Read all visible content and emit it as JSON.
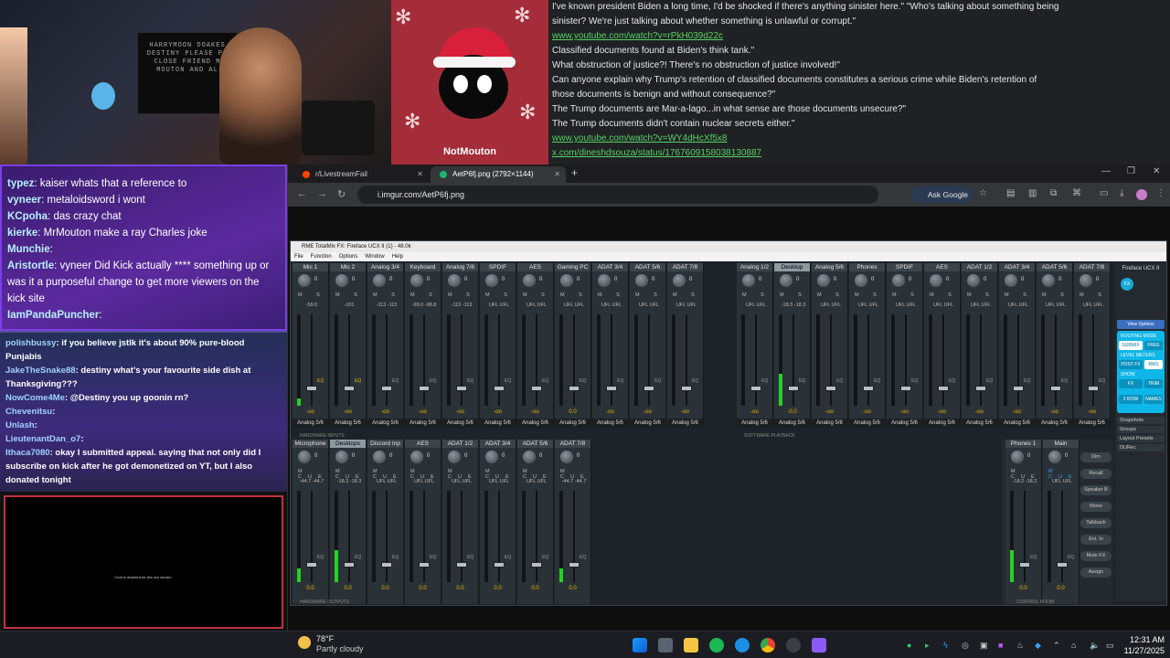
{
  "stream": {
    "webcam_shelf_text": "HARRYMOON DOAKES\nDESTINY PLEASE PL\nCLOSE FRIEND M\nMOUTON AND AL",
    "avatar_name": "NotMouton"
  },
  "article": {
    "lines": [
      {
        "text": "I've known president Biden a long time, I'd be shocked if there's anything sinister here.\" \"Who's talking about something being",
        "link": false
      },
      {
        "text": "sinister? We're just talking about whether something is unlawful or corrupt.\"",
        "link": false
      },
      {
        "text": "www.youtube.com/watch?v=rPkH039d22c",
        "link": true
      },
      {
        "text": "Classified documents found at Biden's think tank.\"",
        "link": false
      },
      {
        "text": "What obstruction of justice?! There's no obstruction of justice involved!\"",
        "link": false
      },
      {
        "text": "Can anyone explain why Trump's retention of classified documents constitutes a serious crime while Biden's retention of",
        "link": false
      },
      {
        "text": "those documents is benign and without consequence?\"",
        "link": false
      },
      {
        "text": "The Trump documents are Mar-a-lago...in what sense are those documents unsecure?\"",
        "link": false
      },
      {
        "text": "The Trump documents didn't contain nuclear secrets either.\"",
        "link": false
      },
      {
        "text": "www.youtube.com/watch?v=WY4dHcXf5x8",
        "link": true
      },
      {
        "text": "x.com/dineshdsouza/status/1767609158038130887",
        "link": true
      }
    ]
  },
  "chat_primary": [
    {
      "user": "typez",
      "text": "kaiser whats that a reference to"
    },
    {
      "user": "vyneer",
      "text": "metaloidsword i wont"
    },
    {
      "user": "KCpoha",
      "text": "das crazy chat"
    },
    {
      "user": "kierke",
      "text": "MrMouton make a ray Charles joke"
    },
    {
      "user": "Munchie",
      "text": ""
    },
    {
      "user": "Aristortle",
      "text": "vyneer Did Kick actually **** something up or was it a purposeful change to get more viewers on the kick site"
    },
    {
      "user": "IamPandaPuncher",
      "text": ""
    }
  ],
  "chat_secondary": [
    {
      "user": "polishbussy",
      "text": "if you believe jstlk it's about 90% pure-blood Punjabis"
    },
    {
      "user": "JakeTheSnake88",
      "text": "destiny what's your favourite side dish at Thanksgiving???"
    },
    {
      "user": "NowCome4Me",
      "text": "@Destiny you up goonin rn?"
    },
    {
      "user": "Chevenitsu",
      "text": ""
    },
    {
      "user": "Unlash",
      "text": ""
    },
    {
      "user": "LieutenantDan_o7",
      "text": ""
    },
    {
      "user": "Ithaca7080",
      "text": "okay I submitted appeal. saying that not only did I subscribe on kick after he got demonetized on YT, but I also donated tonight"
    }
  ],
  "chat_disabled_text": "Chat is disabled for this live stream.",
  "browser": {
    "tabs": [
      {
        "label": "r/LivestreamFail",
        "active": false,
        "color": "#ff4500"
      },
      {
        "label": "AetP6fj.png (2792×1144)",
        "active": true,
        "color": "#1bb76e"
      }
    ],
    "url": "i.imgur.com/AetP6fj.png",
    "ask_google": "Ask Google"
  },
  "mixer": {
    "title": "RME TotalMix FX: Fireface UCX II (1) - 48.0k",
    "menu": [
      "File",
      "Function",
      "Options",
      "Window",
      "Help"
    ],
    "inputs_left": [
      {
        "name": "Mic 1",
        "pk": "-59.0",
        "out": "Analog 5/6",
        "val": "-oo",
        "meter": 0.08,
        "eq": true
      },
      {
        "name": "Mic 2",
        "pk": "-101",
        "out": "Analog 5/6",
        "val": "-oo",
        "meter": 0.0,
        "eq": true
      },
      {
        "name": "Analog 3/4",
        "pk": "-113  -113",
        "out": "Analog 5/6",
        "val": "-oo",
        "meter": 0.0,
        "eq": false
      },
      {
        "name": "Keyboard",
        "pk": "-99.0 -98.8",
        "out": "Analog 5/6",
        "val": "-oo",
        "meter": 0.0,
        "eq": false
      },
      {
        "name": "Analog 7/8",
        "pk": "-113  -113",
        "out": "Analog 5/6",
        "val": "-oo",
        "meter": 0.0,
        "eq": false
      },
      {
        "name": "SPDIF",
        "pk": "UFL  UFL",
        "out": "Analog 5/6",
        "val": "-oo",
        "meter": 0.0,
        "eq": false
      },
      {
        "name": "AES",
        "pk": "UFL  UFL",
        "out": "Analog 5/6",
        "val": "-oo",
        "meter": 0.0,
        "eq": false
      },
      {
        "name": "Gaming PC",
        "pk": "UFL  UFL",
        "out": "Analog 5/6",
        "val": "0.0",
        "meter": 0.0,
        "eq": false
      },
      {
        "name": "ADAT 3/4",
        "pk": "UFL  UFL",
        "out": "Analog 5/6",
        "val": "-oo",
        "meter": 0.0,
        "eq": false
      },
      {
        "name": "ADAT 5/6",
        "pk": "UFL  UFL",
        "out": "Analog 5/6",
        "val": "-oo",
        "meter": 0.0,
        "eq": false
      },
      {
        "name": "ADAT 7/8",
        "pk": "UFL  UFL",
        "out": "Analog 5/6",
        "val": "-oo",
        "meter": 0.0,
        "eq": false
      }
    ],
    "inputs_right": [
      {
        "name": "Analog 1/2",
        "pk": "UFL  UFL",
        "out": "Analog 5/6",
        "val": "-oo",
        "meter": 0.0
      },
      {
        "name": "Desktop",
        "pk": "-18.3 -18.3",
        "out": "Analog 5/6",
        "val": "-0.0",
        "meter": 0.35
      },
      {
        "name": "Analog 5/6",
        "pk": "UFL  UFL",
        "out": "Analog 5/6",
        "val": "-oo",
        "meter": 0.0
      },
      {
        "name": "Phones",
        "pk": "UFL  UFL",
        "out": "Analog 5/6",
        "val": "-oo",
        "meter": 0.0
      },
      {
        "name": "SPDIF",
        "pk": "UFL  UFL",
        "out": "Analog 5/6",
        "val": "-oo",
        "meter": 0.0
      },
      {
        "name": "AES",
        "pk": "UFL  UFL",
        "out": "Analog 5/6",
        "val": "-oo",
        "meter": 0.0
      },
      {
        "name": "ADAT 1/2",
        "pk": "UFL  UFL",
        "out": "Analog 5/6",
        "val": "-oo",
        "meter": 0.0
      },
      {
        "name": "ADAT 3/4",
        "pk": "UFL  UFL",
        "out": "Analog 5/6",
        "val": "-oo",
        "meter": 0.0
      },
      {
        "name": "ADAT 5/6",
        "pk": "UFL  UFL",
        "out": "Analog 5/6",
        "val": "-oo",
        "meter": 0.0
      },
      {
        "name": "ADAT 7/8",
        "pk": "UFL  UFL",
        "out": "Analog 5/6",
        "val": "-oo",
        "meter": 0.0
      }
    ],
    "outputs": [
      {
        "name": "Microphone",
        "pk": "-44.7 -44.7",
        "val": "0.0",
        "meter": 0.15
      },
      {
        "name": "Desktops",
        "pk": "-18.3 -18.3",
        "val": "0.0",
        "meter": 0.35
      },
      {
        "name": "Discord Inp",
        "pk": "UFL  UFL",
        "val": "0.0",
        "meter": 0.0
      },
      {
        "name": "AES",
        "pk": "UFL  UFL",
        "val": "0.0",
        "meter": 0.0
      },
      {
        "name": "ADAT 1/2",
        "pk": "UFL  UFL",
        "val": "0.0",
        "meter": 0.0
      },
      {
        "name": "ADAT 3/4",
        "pk": "UFL  UFL",
        "val": "0.0",
        "meter": 0.0
      },
      {
        "name": "ADAT 5/6",
        "pk": "UFL  UFL",
        "val": "0.0",
        "meter": 0.0
      },
      {
        "name": "ADAT 7/8",
        "pk": "-44.7 -44.7",
        "val": "0.0",
        "meter": 0.15
      }
    ],
    "control_room": [
      {
        "name": "Phones 1",
        "pk": "-18.2 -18.2",
        "val": "0.0",
        "meter": 0.35
      },
      {
        "name": "Main",
        "pk": "UFL  UFL",
        "val": "0.0",
        "meter": 0.0
      }
    ],
    "ctrl_buttons": [
      "Dim",
      "Recall",
      "Speaker B",
      "Mono",
      "Talkback",
      "Ext. In",
      "Mute FX",
      "Assign"
    ],
    "right_panel": {
      "device": "Fireface UCX II",
      "view_options": "View Options",
      "routing_mode": "ROUTING MODE",
      "submix": "SUBMIX",
      "free": "FREE",
      "level_meters": "LEVEL METERS",
      "post_fx": "POST FX",
      "rms": "RMS",
      "show": "SHOW",
      "fx": "FX",
      "trim": "TRIM",
      "two_row": "2 ROW",
      "names": "NAMES",
      "menu": [
        "Snapshots",
        "Groups",
        "Layout Presets",
        "DURec"
      ]
    },
    "labels": {
      "hardware_inputs": "HARDWARE INPUTS",
      "software_playback": "SOFTWARE PLAYBACK",
      "hardware_outputs": "HARDWARE OUTPUTS",
      "control_room": "CONTROL ROOM"
    }
  },
  "taskbar": {
    "temp": "78°F",
    "condition": "Partly cloudy",
    "time": "12:31 AM",
    "date": "11/27/2025"
  }
}
